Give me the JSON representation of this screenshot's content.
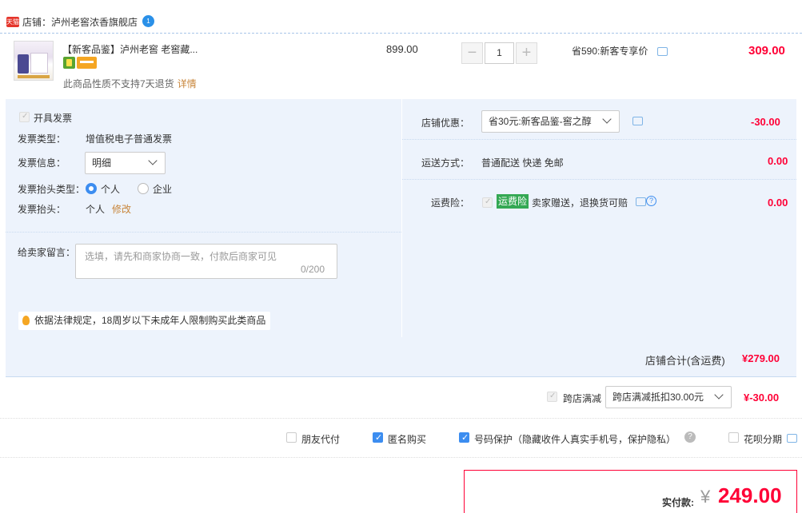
{
  "shop": {
    "badge": "天猫",
    "label": "店铺：泸州老窖浓香旗舰店",
    "chat_badge": "1"
  },
  "product": {
    "title": "【新客品鉴】泸州老窖 老窖藏...",
    "return_note": "此商品性质不支持7天退货",
    "return_detail": "详情",
    "unit_price": "899.00",
    "quantity": "1",
    "qty_minus": "−",
    "qty_plus": "+",
    "save_note": "省590:新客专享价",
    "line_total": "309.00"
  },
  "invoice": {
    "open_label": "开具发票",
    "type_label": "发票类型：",
    "type_value": "增值税电子普通发票",
    "info_label": "发票信息：",
    "info_value": "明细",
    "header_type_label": "发票抬头类型：",
    "header_type_options": [
      "个人",
      "企业"
    ],
    "header_label": "发票抬头：",
    "header_value": "个人",
    "header_edit": "修改"
  },
  "seller_note": {
    "label": "给卖家留言：",
    "placeholder": "选填，请先和商家协商一致，付款后商家可见",
    "counter": "0/200"
  },
  "legal_note": "依据法律规定，18周岁以下未成年人限制购买此类商品",
  "store_discount": {
    "label": "店铺优惠：",
    "selected": "省30元:新客品鉴-窖之醇",
    "value": "-30.00"
  },
  "shipping": {
    "label": "运送方式：",
    "value": "普通配送 快递 免邮",
    "price": "0.00"
  },
  "insurance": {
    "label": "运费险：",
    "tag": "运费险",
    "desc": "卖家赠送，退换货可赔",
    "price": "0.00"
  },
  "shop_total": {
    "label": "店铺合计(含运费)",
    "value": "¥279.00"
  },
  "cross_store": {
    "label": "跨店满减",
    "selected": "跨店满减抵扣30.00元",
    "value": "¥-30.00"
  },
  "services": {
    "friend_pay": "朋友代付",
    "anonymous": "匿名购买",
    "number_protect": "号码保护（隐藏收件人真实手机号，保护隐私）",
    "huabei": "花呗分期"
  },
  "payment": {
    "label": "实付款:",
    "currency": "¥",
    "amount": "249.00"
  },
  "colors": {
    "accent_red": "#ff0036",
    "panel_bg": "#edf3fc",
    "checkbox_blue": "#3c8df0",
    "tag_green": "#34a853"
  }
}
